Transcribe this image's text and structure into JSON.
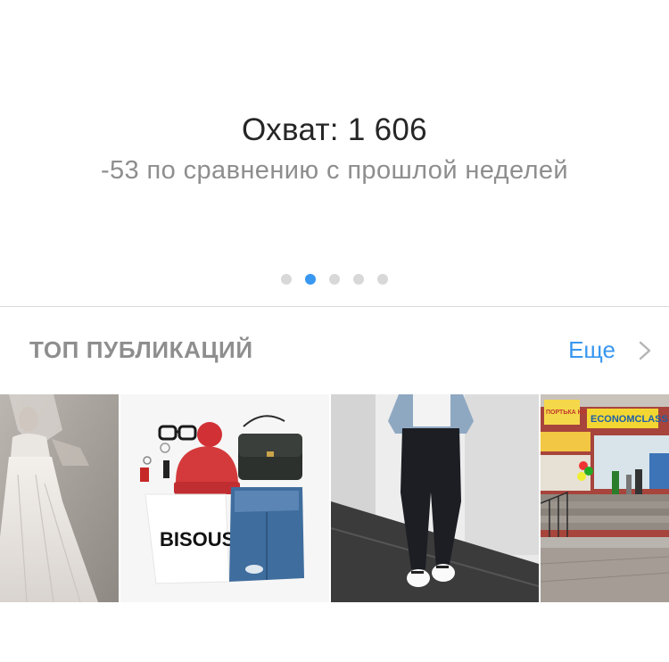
{
  "stats": {
    "title": "Охват: 1 606",
    "subtitle": "-53 по сравнению с прошлой неделей",
    "pager": {
      "count": 5,
      "active_index": 1
    }
  },
  "top_posts": {
    "title": "ТОП ПУБЛИКАЦИЙ",
    "more_label": "Еще",
    "posts": [
      {
        "kind": "vintage-bride-photo"
      },
      {
        "kind": "flatlay-photo",
        "shirt_text": "BISOUS"
      },
      {
        "kind": "street-fashion-photo"
      },
      {
        "kind": "storefront-photo",
        "sign_top": "ПОРТЬКА НА ВАГУ",
        "sign_main": "ECONOMCLASS"
      }
    ]
  },
  "colors": {
    "accent": "#3897f0",
    "text_primary": "#262626",
    "text_secondary": "#8e8e8e",
    "divider": "#dbdbdb"
  },
  "icons": {
    "more_chevron": "chevron-right-icon"
  }
}
